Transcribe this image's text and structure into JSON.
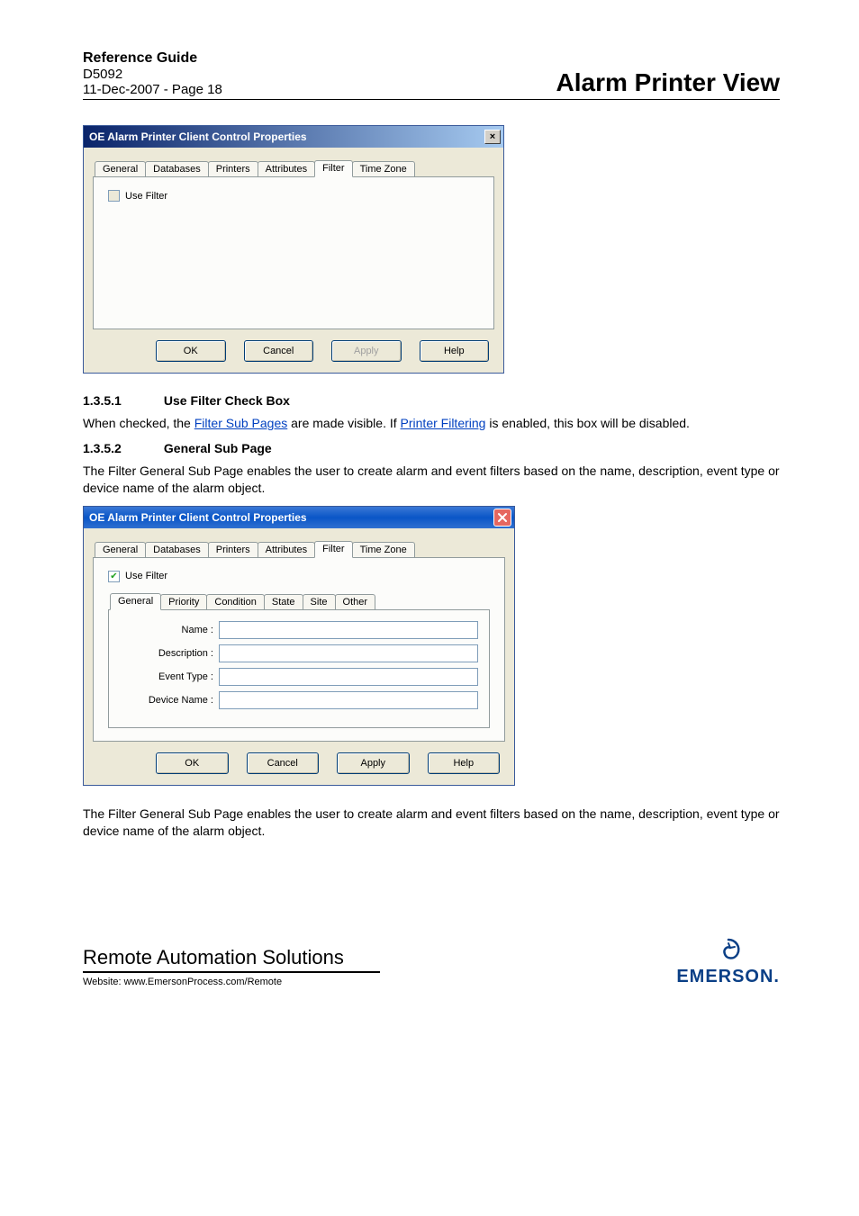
{
  "header": {
    "ref_guide": "Reference Guide",
    "doc_id": "D5092",
    "date_page": "11-Dec-2007 - Page 18",
    "title": "Alarm Printer View"
  },
  "dialog1": {
    "title": "OE Alarm Printer Client Control Properties",
    "close": "×",
    "tabs": [
      "General",
      "Databases",
      "Printers",
      "Attributes",
      "Filter",
      "Time Zone"
    ],
    "active_tab": 4,
    "use_filter_label": "Use Filter",
    "use_filter_checked": false,
    "buttons": {
      "ok": "OK",
      "cancel": "Cancel",
      "apply": "Apply",
      "help": "Help"
    }
  },
  "section1": {
    "num": "1.3.5.1",
    "title": "Use Filter Check Box",
    "text_pre": "When checked, the ",
    "link1": "Filter Sub Pages",
    "text_mid": " are made visible.  If ",
    "link2": "Printer Filtering",
    "text_post": " is enabled, this box will be disabled."
  },
  "section2": {
    "num": "1.3.5.2",
    "title": "General Sub Page",
    "text": "The Filter General Sub Page enables the user to create alarm and event filters based on the name, description, event type or device name of the alarm object."
  },
  "dialog2": {
    "title": "OE Alarm Printer Client Control Properties",
    "close": "×",
    "tabs": [
      "General",
      "Databases",
      "Printers",
      "Attributes",
      "Filter",
      "Time Zone"
    ],
    "active_tab": 4,
    "use_filter_label": "Use Filter",
    "use_filter_checked": true,
    "subtabs": [
      "General",
      "Priority",
      "Condition",
      "State",
      "Site",
      "Other"
    ],
    "active_subtab": 0,
    "fields": {
      "name": "Name :",
      "description": "Description :",
      "event_type": "Event Type :",
      "device_name": "Device Name :"
    },
    "buttons": {
      "ok": "OK",
      "cancel": "Cancel",
      "apply": "Apply",
      "help": "Help"
    }
  },
  "trailing_para": "The Filter General Sub Page enables the user to create alarm and event filters based on the name, description, event type or device name of the alarm object.",
  "footer": {
    "ras": "Remote Automation Solutions",
    "website": "Website:  www.EmersonProcess.com/Remote",
    "brand": "EMERSON."
  }
}
